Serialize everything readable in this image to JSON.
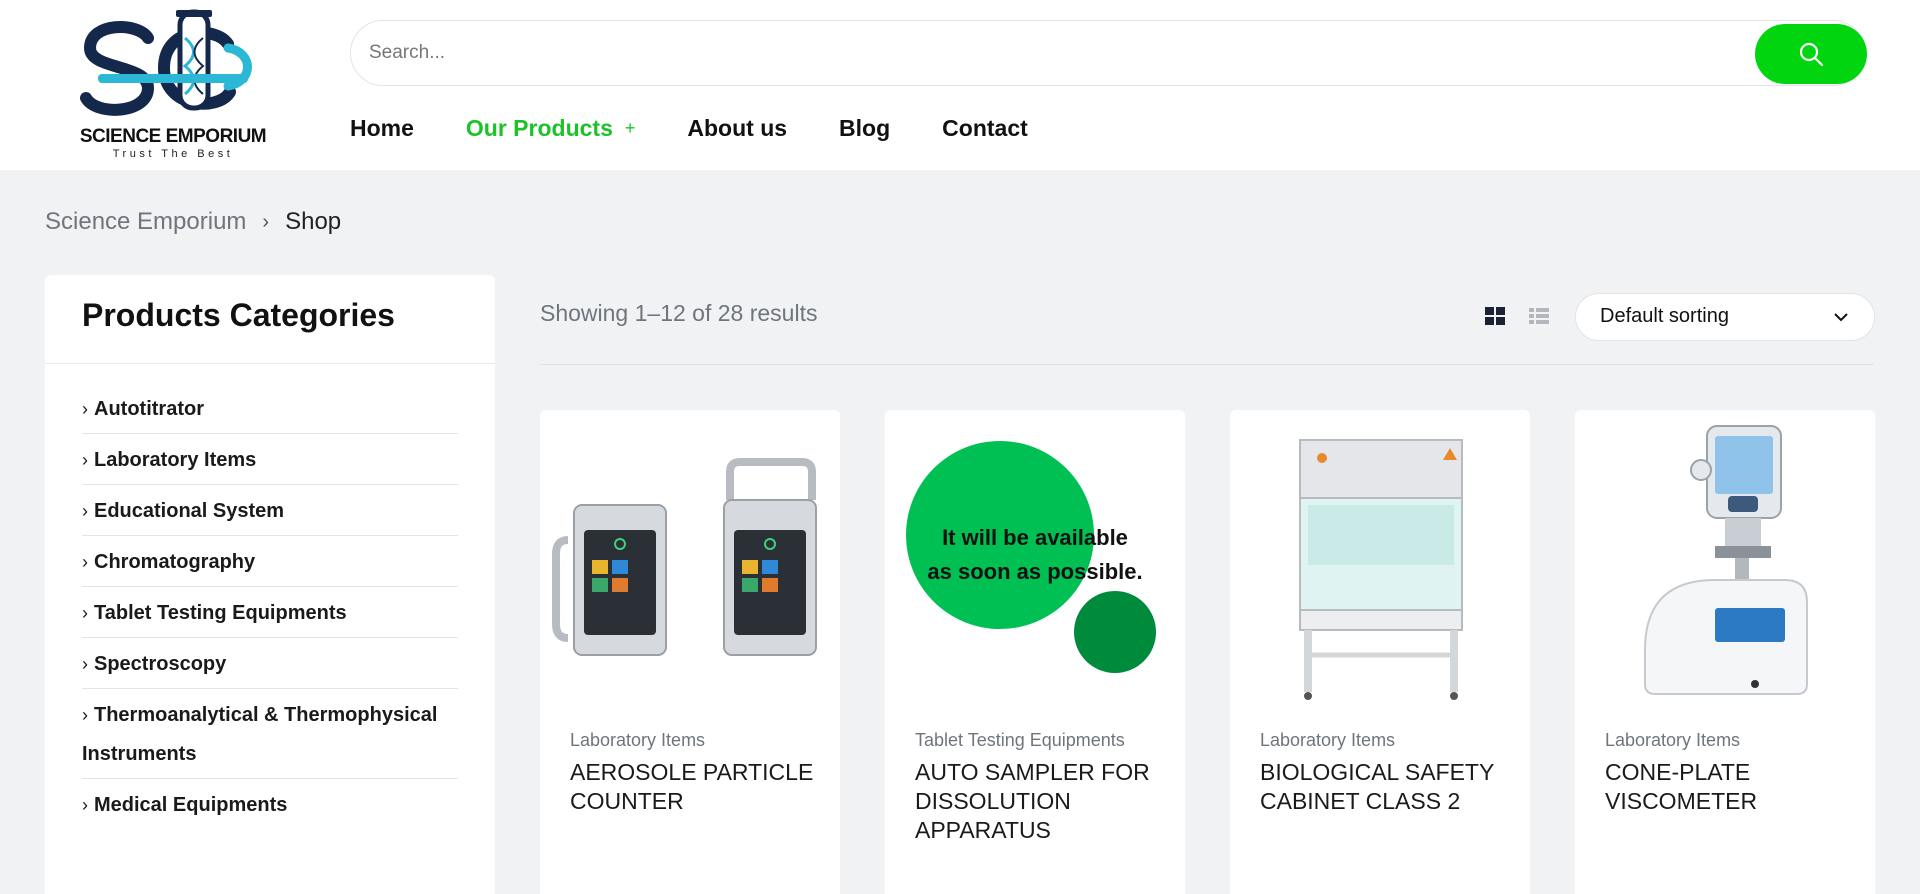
{
  "brand": {
    "name": "SCIENCE EMPORIUM",
    "tagline": "Trust The Best",
    "accent": "#1cc228",
    "button_green": "#00d50f"
  },
  "search": {
    "placeholder": "Search..."
  },
  "nav": {
    "items": [
      {
        "label": "Home",
        "active": false
      },
      {
        "label": "Our Products",
        "active": true,
        "has_submenu": true
      },
      {
        "label": "About us",
        "active": false
      },
      {
        "label": "Blog",
        "active": false
      },
      {
        "label": "Contact",
        "active": false
      }
    ]
  },
  "breadcrumb": {
    "home": "Science Emporium",
    "current": "Shop"
  },
  "sidebar": {
    "title": "Products Categories",
    "items": [
      {
        "label": "Autotitrator"
      },
      {
        "label": "Laboratory Items"
      },
      {
        "label": "Educational System"
      },
      {
        "label": "Chromatography"
      },
      {
        "label": "Tablet Testing Equipments"
      },
      {
        "label": "Spectroscopy"
      },
      {
        "label": "Thermoanalytical & Thermophysical Instruments"
      },
      {
        "label": "Medical Equipments"
      }
    ]
  },
  "toolbar": {
    "result_count": "Showing 1–12 of 28 results",
    "sort_label": "Default sorting"
  },
  "products": [
    {
      "category": "Laboratory Items",
      "title": "AEROSOLE PARTICLE COUNTER",
      "image": "aerosol-particle-counter-image"
    },
    {
      "category": "Tablet Testing Equipments",
      "title": "AUTO SAMPLER FOR DISSOLUTION APPARATUS",
      "image": "placeholder-image",
      "image_text": "It will be available as soon as possible."
    },
    {
      "category": "Laboratory Items",
      "title": "BIOLOGICAL SAFETY CABINET CLASS 2",
      "image": "safety-cabinet-image"
    },
    {
      "category": "Laboratory Items",
      "title": "CONE-PLATE VISCOMETER",
      "image": "viscometer-image"
    }
  ]
}
